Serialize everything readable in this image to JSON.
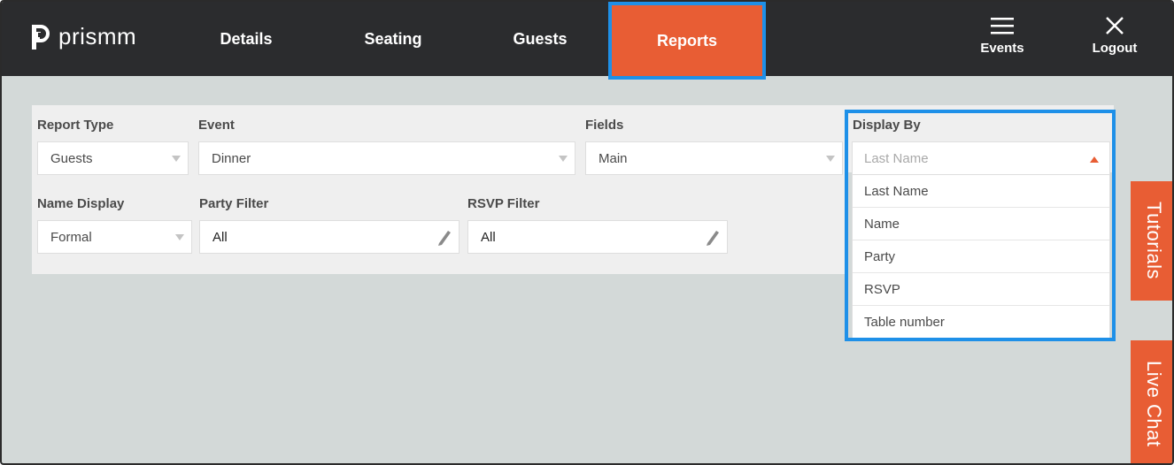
{
  "brand": {
    "name": "prismm"
  },
  "nav": {
    "items": [
      {
        "label": "Details"
      },
      {
        "label": "Seating"
      },
      {
        "label": "Guests"
      },
      {
        "label": "Reports"
      }
    ],
    "active": "Reports"
  },
  "top_actions": {
    "events_label": "Events",
    "logout_label": "Logout"
  },
  "filters": {
    "report_type": {
      "label": "Report Type",
      "value": "Guests"
    },
    "event": {
      "label": "Event",
      "value": "Dinner"
    },
    "fields": {
      "label": "Fields",
      "value": "Main"
    },
    "name_display": {
      "label": "Name Display",
      "value": "Formal"
    },
    "party_filter": {
      "label": "Party Filter",
      "value": "All"
    },
    "rsvp_filter": {
      "label": "RSVP Filter",
      "value": "All"
    },
    "display_by": {
      "label": "Display By",
      "placeholder": "Last Name",
      "options": [
        "Last Name",
        "Name",
        "Party",
        "RSVP",
        "Table number"
      ]
    }
  },
  "side_tabs": {
    "tutorials": "Tutorials",
    "live_chat": "Live Chat"
  },
  "colors": {
    "accent": "#e85d34",
    "highlight": "#1e90e8",
    "topbar": "#2b2c2e",
    "background": "#d3d9d8"
  },
  "icons": {
    "menu": "hamburger-icon",
    "close": "close-icon",
    "caret": "caret-down-icon",
    "caret_up": "caret-up-icon",
    "edit": "pencil-icon"
  }
}
